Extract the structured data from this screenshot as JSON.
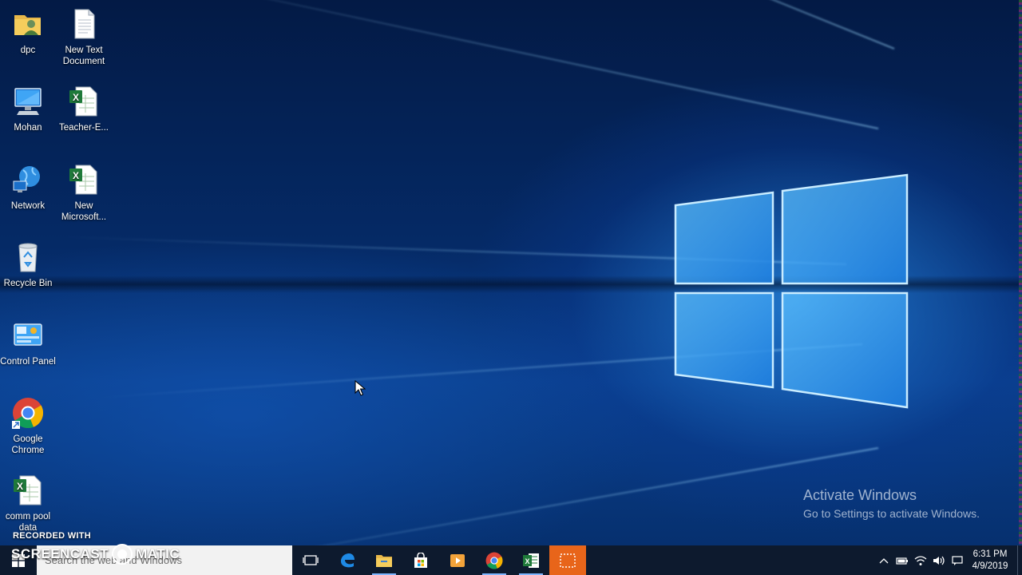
{
  "desktop": {
    "icons": [
      {
        "label": "dpc",
        "icon": "user-folder-icon"
      },
      {
        "label": "New Text Document",
        "icon": "text-document-icon"
      },
      {
        "label": "Mohan",
        "icon": "computer-icon"
      },
      {
        "label": "Teacher-E...",
        "icon": "excel-file-icon"
      },
      {
        "label": "Network",
        "icon": "network-icon"
      },
      {
        "label": "New Microsoft...",
        "icon": "excel-file-icon"
      },
      {
        "label": "Recycle Bin",
        "icon": "recycle-bin-icon"
      },
      {
        "label": "Control Panel",
        "icon": "control-panel-icon"
      },
      {
        "label": "Google Chrome",
        "icon": "chrome-icon"
      },
      {
        "label": "comm pool data",
        "icon": "excel-file-icon"
      }
    ]
  },
  "watermark": {
    "activate_title": "Activate Windows",
    "activate_subtitle": "Go to Settings to activate Windows.",
    "recorded_with": "RECORDED WITH",
    "screencast_left": "SCREENCAST",
    "screencast_right": "MATIC"
  },
  "taskbar": {
    "search_placeholder": "Search the web and Windows",
    "apps": [
      {
        "name": "task-view",
        "icon": "task-view-icon"
      },
      {
        "name": "edge",
        "icon": "edge-icon"
      },
      {
        "name": "file-explorer",
        "icon": "folder-icon"
      },
      {
        "name": "store",
        "icon": "store-icon"
      },
      {
        "name": "media-player",
        "icon": "media-icon"
      },
      {
        "name": "chrome",
        "icon": "chrome-icon"
      },
      {
        "name": "excel",
        "icon": "excel-icon"
      },
      {
        "name": "snipping-tool",
        "icon": "snipping-icon"
      }
    ],
    "clock_time": "6:31 PM",
    "clock_date": "4/9/2019"
  },
  "colors": {
    "taskbar_bg": "#0d1a2e",
    "highlight_app": "#e8651a",
    "wallpaper_blue": "#0a3f8c"
  }
}
